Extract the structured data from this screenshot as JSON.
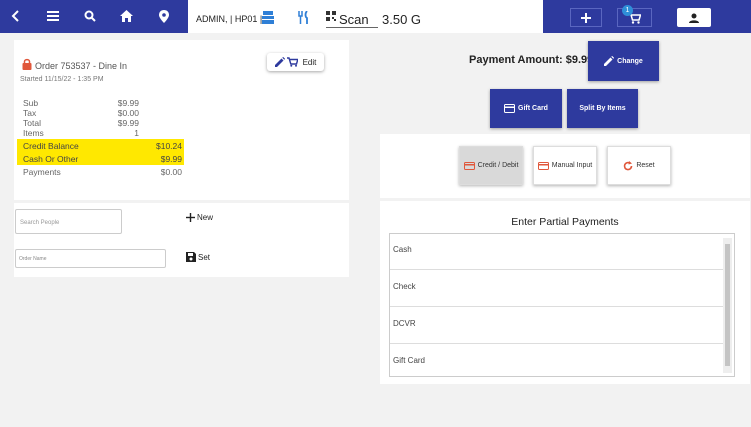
{
  "topbar": {
    "admin_label": "ADMIN, | HP01 |",
    "scan_label": "Scan",
    "version": "3.50 G",
    "cart_badge": "1"
  },
  "order": {
    "title": "Order 753537 - Dine In",
    "started": "Started 11/15/22 - 1:35 PM",
    "edit_label": "Edit",
    "summary": [
      {
        "label": "Sub",
        "value": "$9.99"
      },
      {
        "label": "Tax",
        "value": "$0.00"
      },
      {
        "label": "Total",
        "value": "$9.99"
      },
      {
        "label": "Items",
        "value": "1"
      }
    ],
    "credit_balance": {
      "label": "Credit Balance",
      "value": "$10.24"
    },
    "cash_or_other": {
      "label": "Cash Or Other",
      "value": "$9.99"
    },
    "payments": {
      "label": "Payments",
      "value": "$0.00"
    },
    "highlight_color": "#ffe800"
  },
  "people": {
    "search_placeholder": "Search People",
    "order_name_placeholder": "Order Name",
    "new_label": "New",
    "set_label": "Set"
  },
  "payment": {
    "amount_label": "Payment Amount: $9.99",
    "change_label": "Change",
    "gift_card_label": "Gift Card",
    "split_label": "Split By Items",
    "credit_debit_label": "Credit / Debit",
    "manual_input_label": "Manual Input",
    "reset_label": "Reset",
    "partial_title": "Enter Partial Payments",
    "partial_items": [
      "Cash",
      "Check",
      "DCVR",
      "Gift Card"
    ]
  },
  "colors": {
    "brand": "#2e3a9e",
    "accent_icon": "#2f7fd6",
    "card_icon": "#e0573b"
  }
}
